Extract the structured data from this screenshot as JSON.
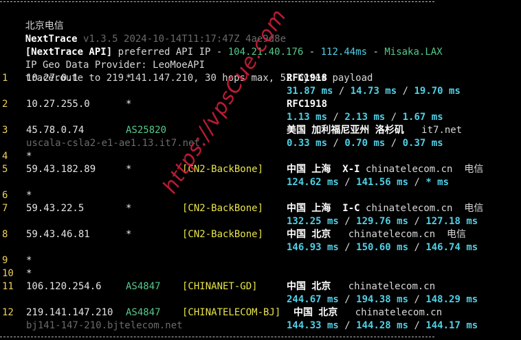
{
  "header": {
    "isp_label": "北京电信",
    "app_name": "NextTrace",
    "version": "v1.3.5 2024-10-14T11:17:47Z 4ae9d8e",
    "api_prefix": "[NextTrace API]",
    "api_text": " preferred API IP - ",
    "api_ip": "104.21.40.176",
    "sep1": " - ",
    "api_latency": "112.44ms",
    "sep2": " - ",
    "api_node": "Misaka.LAX",
    "geo_provider": "IP Geo Data Provider: LeoMoeAPI",
    "traceroute": "traceroute to 219.141.147.210, 30 hops max, 52 bytes payload"
  },
  "hops": [
    {
      "num": "1",
      "ip": "10.27.0.1",
      "asn": "*",
      "tag": "",
      "geo": "RFC1918",
      "host": "",
      "rtt": [
        "31.87 ms",
        "14.73 ms",
        "19.70 ms"
      ]
    },
    {
      "num": "2",
      "ip": "10.27.255.0",
      "asn": "*",
      "tag": "",
      "geo": "RFC1918",
      "host": "",
      "rtt": [
        "1.13 ms",
        "2.13 ms",
        "1.67 ms"
      ]
    },
    {
      "num": "3",
      "ip": "45.78.0.74",
      "asn": "AS25820",
      "tag": "",
      "geo": "美国 加利福尼亚州 洛杉矶",
      "host": "it7.net",
      "rdns": "uscala-csla2-e1-ae1.13.it7.net",
      "rtt": [
        "0.33 ms",
        "0.70 ms",
        "0.37 ms"
      ]
    },
    {
      "num": "4",
      "ip": "*"
    },
    {
      "num": "5",
      "ip": "59.43.182.89",
      "asn": "*",
      "tag": "[CN2-BackBone]",
      "geo": "中国 上海",
      "net": "X-I",
      "host": "chinatelecom.cn",
      "carrier": "电信",
      "rtt": [
        "124.62 ms",
        "141.56 ms",
        "* ms"
      ]
    },
    {
      "num": "6",
      "ip": "*"
    },
    {
      "num": "7",
      "ip": "59.43.22.5",
      "asn": "*",
      "tag": "[CN2-BackBone]",
      "geo": "中国 上海",
      "net": "I-C",
      "host": "chinatelecom.cn",
      "carrier": "电信",
      "rtt": [
        "132.25 ms",
        "129.76 ms",
        "127.18 ms"
      ]
    },
    {
      "num": "8",
      "ip": "59.43.46.81",
      "asn": "*",
      "tag": "[CN2-BackBone]",
      "geo": "中国 北京",
      "host": "chinatelecom.cn",
      "carrier": "电信",
      "rtt": [
        "146.93 ms",
        "150.60 ms",
        "146.74 ms"
      ]
    },
    {
      "num": "9",
      "ip": "*"
    },
    {
      "num": "10",
      "ip": "*"
    },
    {
      "num": "11",
      "ip": "106.120.254.6",
      "asn": "AS4847",
      "tag": "[CHINANET-GD]",
      "geo": "中国 北京",
      "host": "chinatelecom.cn",
      "rtt": [
        "244.67 ms",
        "194.38 ms",
        "148.29 ms"
      ]
    },
    {
      "num": "12",
      "ip": "219.141.147.210",
      "asn": "AS4847",
      "tag": "[CHINATELECOM-BJ]",
      "geo": "中国 北京",
      "host": "chinatelecom.cn",
      "rdns": "bj141-147-210.bjtelecom.net",
      "rtt": [
        "144.33 ms",
        "144.28 ms",
        "144.17 ms"
      ]
    }
  ],
  "rtt_sep": " / ",
  "watermark": "https://vpsCue.com",
  "colors": {
    "background": "#000000",
    "ip": "#e6e6e6",
    "asn": "#56c98a",
    "tag": "#e8e44a",
    "rtt": "#4fd0e6",
    "dim": "#6b6b6b",
    "hop_num": "#f0d15a",
    "watermark": "#dc1e3c"
  }
}
